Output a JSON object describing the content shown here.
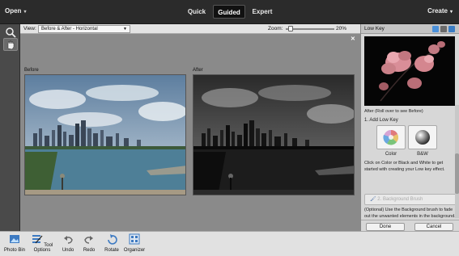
{
  "topbar": {
    "open_label": "Open",
    "modes": [
      "Quick",
      "Guided",
      "Expert"
    ],
    "active_mode": "Guided",
    "create_label": "Create"
  },
  "options": {
    "view_label": "View:",
    "view_value": "Before & After - Horizontal",
    "zoom_label": "Zoom:",
    "zoom_value": "20%",
    "zoom_level": 0.05
  },
  "canvas": {
    "before_label": "Before",
    "after_label": "After"
  },
  "panel": {
    "title": "Low Key",
    "caption": "After (Roll over to see Before)",
    "step1": "1. Add Low Key",
    "color_label": "Color",
    "bw_label": "B&W",
    "hint1": "Click on Color or Black and White to get started with creating your Low key effect.",
    "brush_label": "2.  Background Brush",
    "hint2": "(Optional) Use the Background brush to fade out the unwanted elements in the background. This enhances the overall Low Key effect.",
    "done_label": "Done",
    "cancel_label": "Cancel"
  },
  "bottombar": {
    "items": [
      "Photo Bin",
      "Tool Options",
      "Undo",
      "Redo",
      "Rotate",
      "Organizer"
    ]
  }
}
